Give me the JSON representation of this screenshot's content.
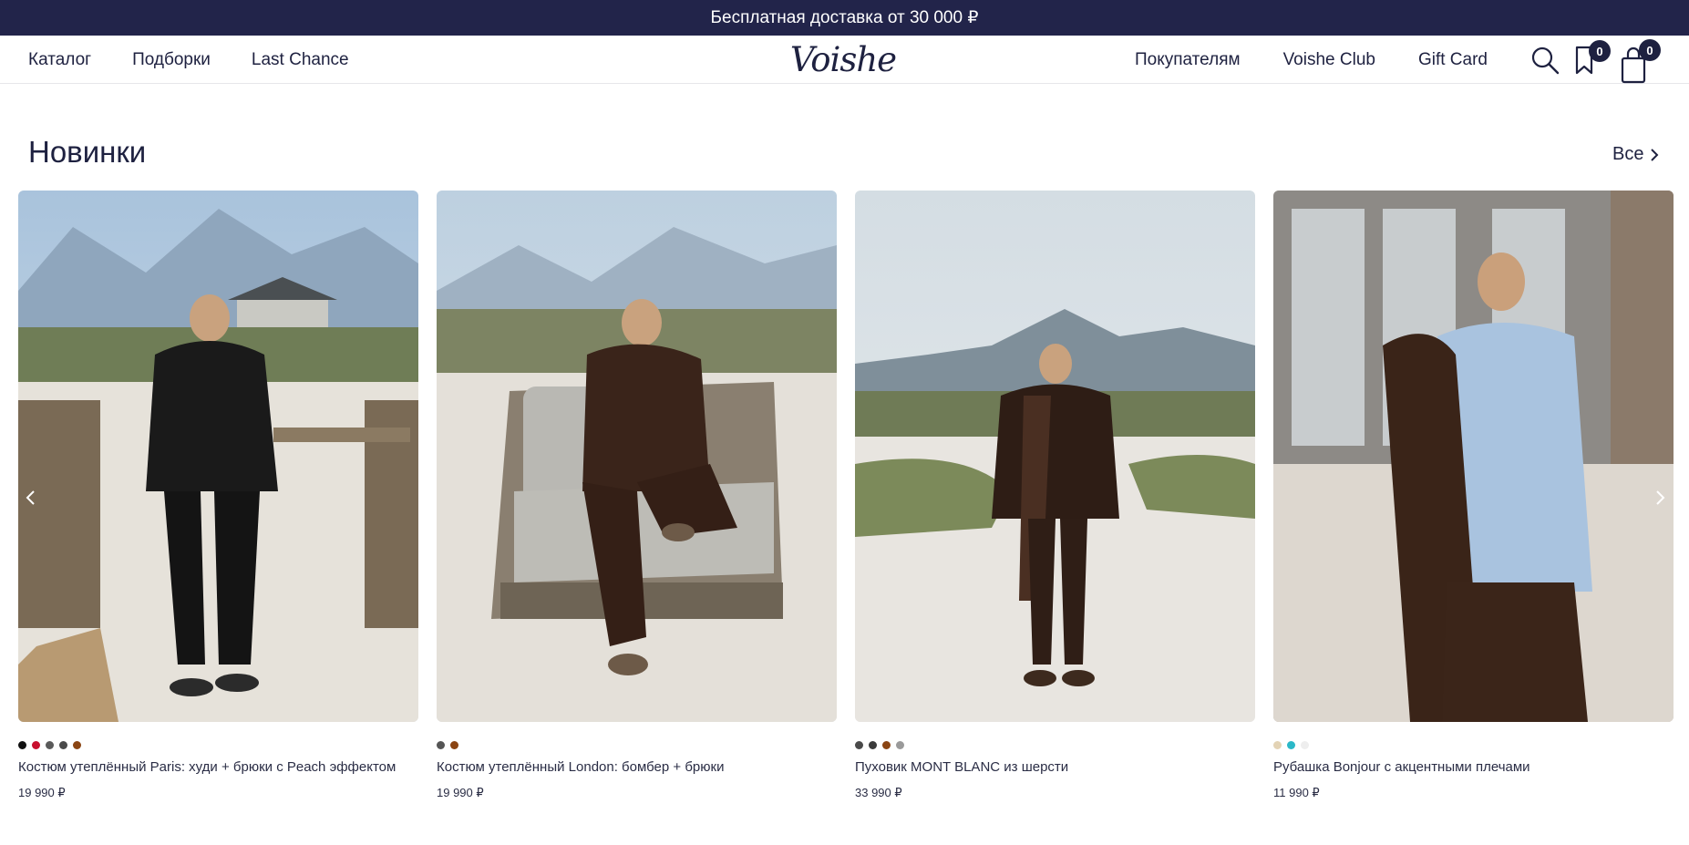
{
  "promo": {
    "text": "Бесплатная доставка от 30 000 ₽"
  },
  "header": {
    "nav_left": [
      "Каталог",
      "Подборки",
      "Last Chance"
    ],
    "logo": "Voishe",
    "nav_right": [
      "Покупателям",
      "Voishe Club",
      "Gift Card"
    ],
    "bookmark_count": "0",
    "cart_count": "0"
  },
  "section": {
    "title": "Новинки",
    "all_label": "Все"
  },
  "products": [
    {
      "name": "Костюм утеплённый Paris: худи + брюки с Peach эффектом",
      "price": "19 990 ₽",
      "swatches": [
        "#111111",
        "#c8102e",
        "#5a5a5a",
        "#4a4a4a",
        "#8b4513"
      ]
    },
    {
      "name": "Костюм утеплённый London: бомбер + брюки",
      "price": "19 990 ₽",
      "swatches": [
        "#555555",
        "#8b4513"
      ]
    },
    {
      "name": "Пуховик MONT BLANC из шерсти",
      "price": "33 990 ₽",
      "swatches": [
        "#4a4a4a",
        "#3b3b3b",
        "#8b4513",
        "#9a9a9a"
      ]
    },
    {
      "name": "Рубашка Bonjour с акцентными плечами",
      "price": "11 990 ₽",
      "swatches": [
        "#e3d3b5",
        "#2bb8c8",
        "#eeeeee"
      ]
    }
  ],
  "colors": {
    "header_bg": "#22244a",
    "text": "#1e2140"
  }
}
